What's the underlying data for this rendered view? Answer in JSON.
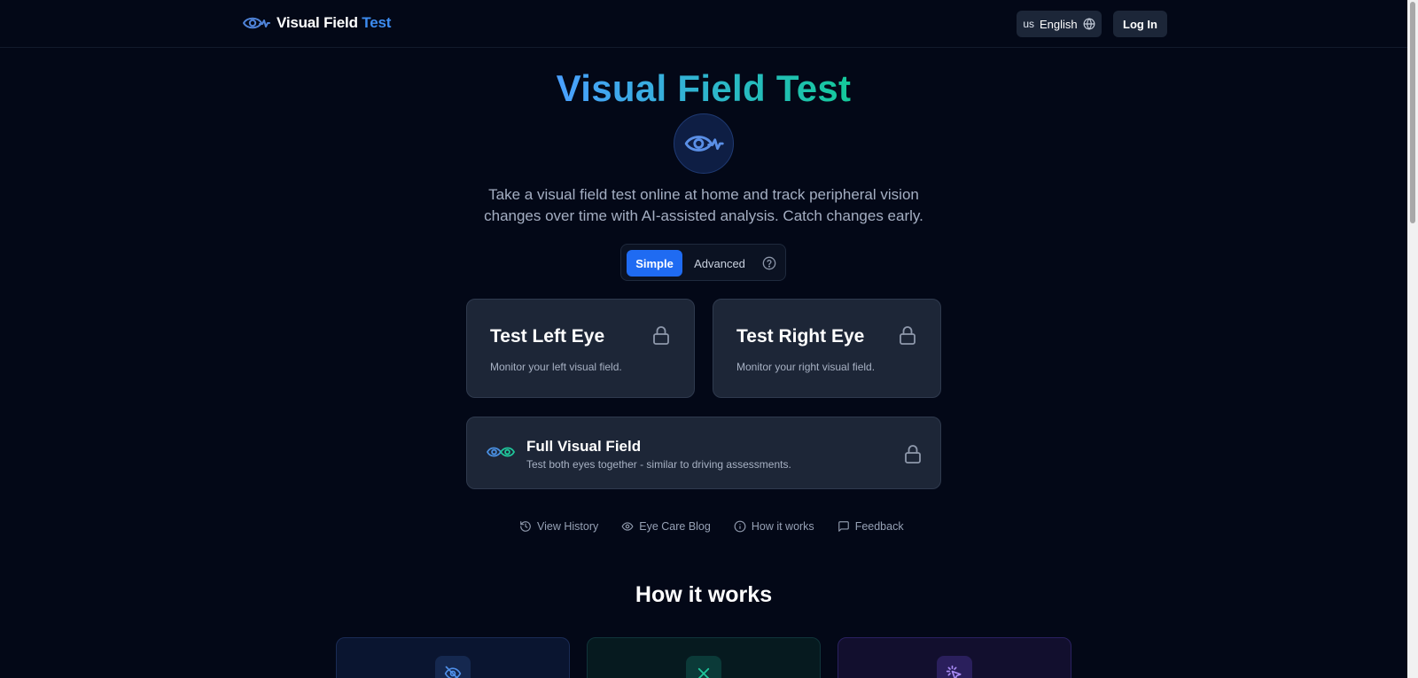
{
  "header": {
    "brand_word1": "Visual Field",
    "brand_word2": "Test",
    "language_code": "us",
    "language_label": "English",
    "login_label": "Log In"
  },
  "hero": {
    "title": "Visual Field Test",
    "subtitle": "Take a visual field test online at home and track peripheral vision changes over time with AI-assisted analysis. Catch changes early."
  },
  "mode_toggle": {
    "simple_label": "Simple",
    "advanced_label": "Advanced",
    "selected": "Simple"
  },
  "cards": {
    "left": {
      "title": "Test Left Eye",
      "description": "Monitor your left visual field.",
      "icon": "lock-icon"
    },
    "right": {
      "title": "Test Right Eye",
      "description": "Monitor your right visual field.",
      "icon": "lock-icon"
    },
    "full": {
      "title": "Full Visual Field",
      "description": "Test both eyes together - similar to driving assessments.",
      "icon": "lock-icon"
    }
  },
  "links": [
    {
      "label": "View History",
      "icon": "history-icon"
    },
    {
      "label": "Eye Care Blog",
      "icon": "eye-icon"
    },
    {
      "label": "How it works",
      "icon": "info-icon"
    },
    {
      "label": "Feedback",
      "icon": "chat-icon"
    }
  ],
  "how_it_works": {
    "title": "How it works",
    "steps": [
      {
        "icon": "eye-off-icon"
      },
      {
        "icon": "x-icon"
      },
      {
        "icon": "cursor-click-icon"
      }
    ]
  },
  "colors": {
    "background": "#030817",
    "accent_blue": "#1f6bf2",
    "brand_blue": "#3d8cf0",
    "brand_green": "#14c99a",
    "card_bg": "#1d2637"
  }
}
